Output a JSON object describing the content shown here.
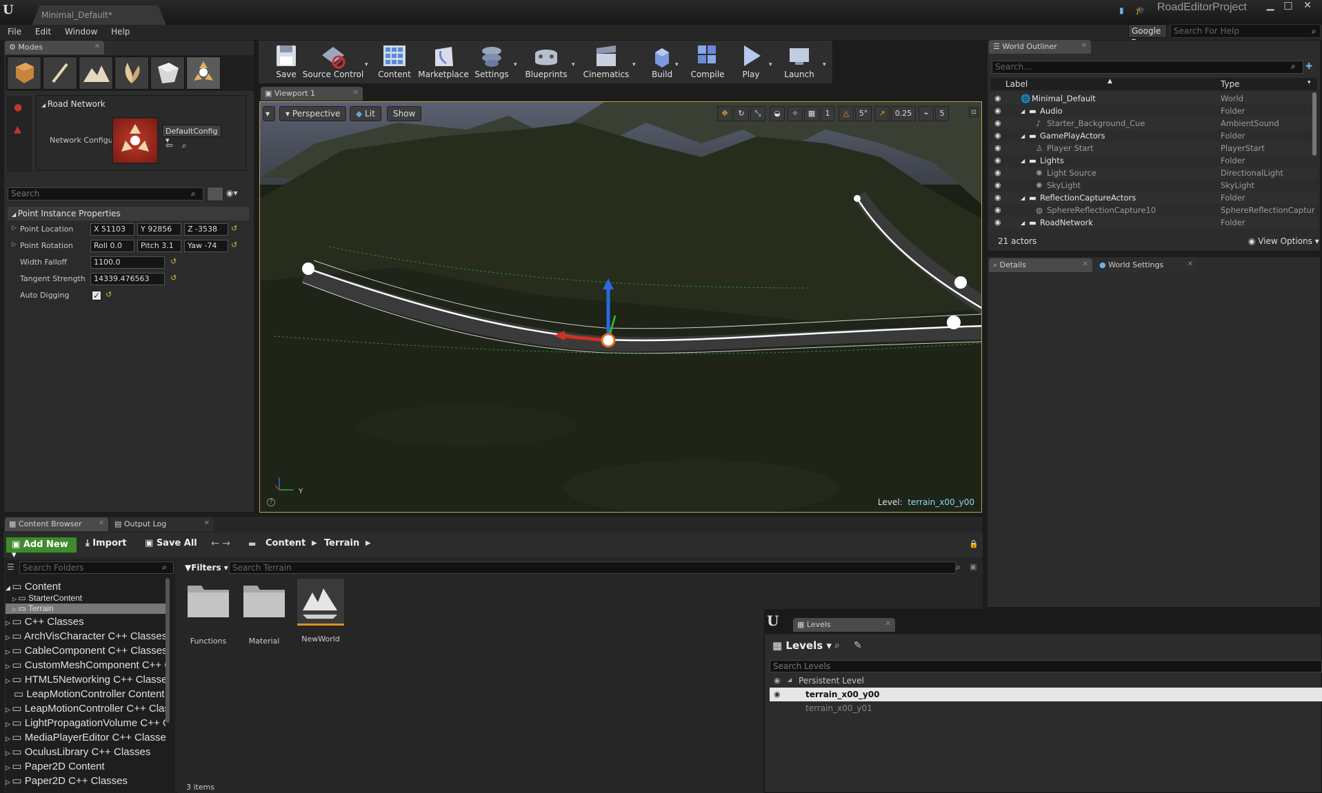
{
  "app": {
    "document_tab": "Minimal_Default*",
    "project_name": "RoadEditorProject"
  },
  "menu": [
    "File",
    "Edit",
    "Window",
    "Help"
  ],
  "help_search": {
    "provider": "Google",
    "placeholder": "Search For Help"
  },
  "modes": {
    "tab_label": "Modes",
    "road_network_title": "Road Network",
    "network_config_label": "Network Configu",
    "network_config_value": "DefaultConfig",
    "search_placeholder": "Search",
    "section_title": "Point Instance Properties",
    "properties": {
      "point_location": {
        "label": "Point Location",
        "x": "X 51103",
        "y": "Y 92856",
        "z": "Z -3538"
      },
      "point_rotation": {
        "label": "Point Rotation",
        "roll": "Roll 0.0",
        "pitch": "Pitch 3.1",
        "yaw": "Yaw -74"
      },
      "width_falloff": {
        "label": "Width Falloff",
        "value": "1100.0"
      },
      "tangent_strength": {
        "label": "Tangent Strength",
        "value": "14339.476563"
      },
      "auto_digging": {
        "label": "Auto Digging",
        "checked": true
      }
    }
  },
  "toolbar": {
    "buttons": [
      {
        "label": "Save"
      },
      {
        "label": "Source Control"
      },
      {
        "label": "Content"
      },
      {
        "label": "Marketplace"
      },
      {
        "label": "Settings"
      },
      {
        "label": "Blueprints"
      },
      {
        "label": "Cinematics"
      },
      {
        "label": "Build"
      },
      {
        "label": "Compile"
      },
      {
        "label": "Play"
      },
      {
        "label": "Launch"
      }
    ]
  },
  "viewport": {
    "tab_label": "Viewport 1",
    "perspective": "Perspective",
    "lit": "Lit",
    "show": "Show",
    "grid_value": "1",
    "rotation_snap": "5°",
    "scale_snap": "0.25",
    "camera_speed": "5",
    "level_label": "Level:",
    "level_value": "terrain_x00_y00",
    "axis_y": "Y"
  },
  "outliner": {
    "tab_label": "World Outliner",
    "search_placeholder": "Search...",
    "col_label": "Label",
    "col_type": "Type",
    "rows": [
      {
        "name": "Minimal_Default",
        "type": "World"
      },
      {
        "name": "Audio",
        "type": "Folder"
      },
      {
        "name": "Starter_Background_Cue",
        "type": "AmbientSound"
      },
      {
        "name": "GamePlayActors",
        "type": "Folder"
      },
      {
        "name": "Player Start",
        "type": "PlayerStart"
      },
      {
        "name": "Lights",
        "type": "Folder"
      },
      {
        "name": "Light Source",
        "type": "DirectionalLight"
      },
      {
        "name": "SkyLight",
        "type": "SkyLight"
      },
      {
        "name": "ReflectionCaptureActors",
        "type": "Folder"
      },
      {
        "name": "SphereReflectionCapture10",
        "type": "SphereReflectionCaptur"
      },
      {
        "name": "RoadNetwork",
        "type": "Folder"
      }
    ],
    "actor_count": "21 actors",
    "view_options": "View Options"
  },
  "details": {
    "tab_label": "Details",
    "world_settings_label": "World Settings"
  },
  "content_browser": {
    "tab_label": "Content Browser",
    "output_log_label": "Output Log",
    "add_new": "Add New",
    "import": "Import",
    "save_all": "Save All",
    "breadcrumb": [
      "Content",
      "Terrain"
    ],
    "folder_search_placeholder": "Search Folders",
    "filters": "Filters",
    "asset_search_placeholder": "Search Terrain",
    "tree": [
      {
        "label": "Content"
      },
      {
        "label": "StarterContent"
      },
      {
        "label": "Terrain"
      },
      {
        "label": "C++ Classes"
      },
      {
        "label": "ArchVisCharacter C++ Classes"
      },
      {
        "label": "CableComponent C++ Classes"
      },
      {
        "label": "CustomMeshComponent C++ Classes"
      },
      {
        "label": "HTML5Networking C++ Classes"
      },
      {
        "label": "LeapMotionController Content"
      },
      {
        "label": "LeapMotionController C++ Classes"
      },
      {
        "label": "LightPropagationVolume C++ Classes"
      },
      {
        "label": "MediaPlayerEditor C++ Classes"
      },
      {
        "label": "OculusLibrary C++ Classes"
      },
      {
        "label": "Paper2D Content"
      },
      {
        "label": "Paper2D C++ Classes"
      }
    ],
    "assets": [
      {
        "label": "Functions"
      },
      {
        "label": "Material"
      },
      {
        "label": "NewWorld"
      }
    ],
    "item_count": "3 items"
  },
  "levels": {
    "tab_label": "Levels",
    "menu_label": "Levels",
    "search_placeholder": "Search Levels",
    "rows": [
      {
        "name": "Persistent Level"
      },
      {
        "name": "terrain_x00_y00"
      },
      {
        "name": "terrain_x00_y01"
      }
    ]
  },
  "colors": {
    "accent_green": "#3f8a2e",
    "selection_gold": "#b9a54f",
    "level_cyan": "#8fdcf5"
  }
}
